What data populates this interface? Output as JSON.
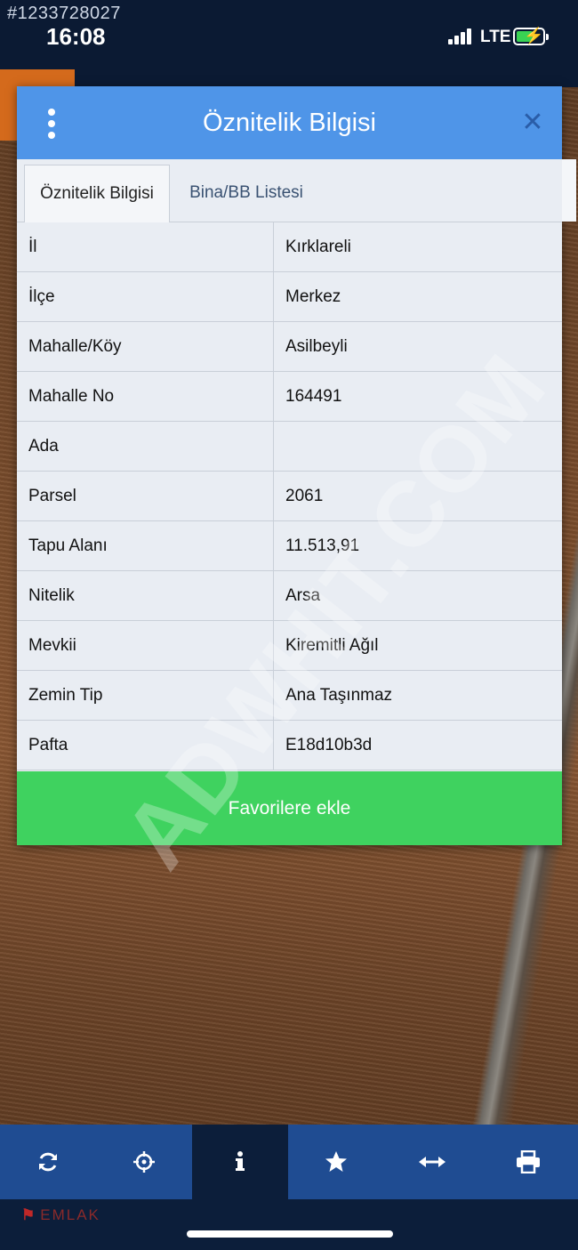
{
  "status_bar": {
    "listing_id": "#1233728027",
    "time": "16:08",
    "network": "LTE"
  },
  "dialog": {
    "title": "Öznitelik Bilgisi",
    "tabs": [
      {
        "label": "Öznitelik Bilgisi",
        "active": true
      },
      {
        "label": "Bina/BB Listesi",
        "active": false
      }
    ],
    "rows": [
      {
        "key": "İl",
        "value": "Kırklareli"
      },
      {
        "key": "İlçe",
        "value": "Merkez"
      },
      {
        "key": "Mahalle/Köy",
        "value": "Asilbeyli"
      },
      {
        "key": "Mahalle No",
        "value": "164491"
      },
      {
        "key": "Ada",
        "value": ""
      },
      {
        "key": "Parsel",
        "value": "2061"
      },
      {
        "key": "Tapu Alanı",
        "value": "11.513,91"
      },
      {
        "key": "Nitelik",
        "value": "Arsa"
      },
      {
        "key": "Mevkii",
        "value": "Kiremitli Ağıl"
      },
      {
        "key": "Zemin Tip",
        "value": "Ana Taşınmaz"
      },
      {
        "key": "Pafta",
        "value": "E18d10b3d"
      }
    ],
    "favorite_button": "Favorilere ekle"
  },
  "watermark": "ADWHIT.COM",
  "toolbar": {
    "items": [
      {
        "icon": "refresh-icon"
      },
      {
        "icon": "crosshair-icon"
      },
      {
        "icon": "info-icon",
        "active": true
      },
      {
        "icon": "star-icon"
      },
      {
        "icon": "measure-arrows-icon"
      },
      {
        "icon": "print-icon"
      }
    ]
  },
  "brand": "EMLAK",
  "colors": {
    "header": "#4f95e8",
    "favorite_button": "#3fd25f",
    "toolbar": "#1f4c92",
    "toolbar_active": "#0c1e3a"
  }
}
